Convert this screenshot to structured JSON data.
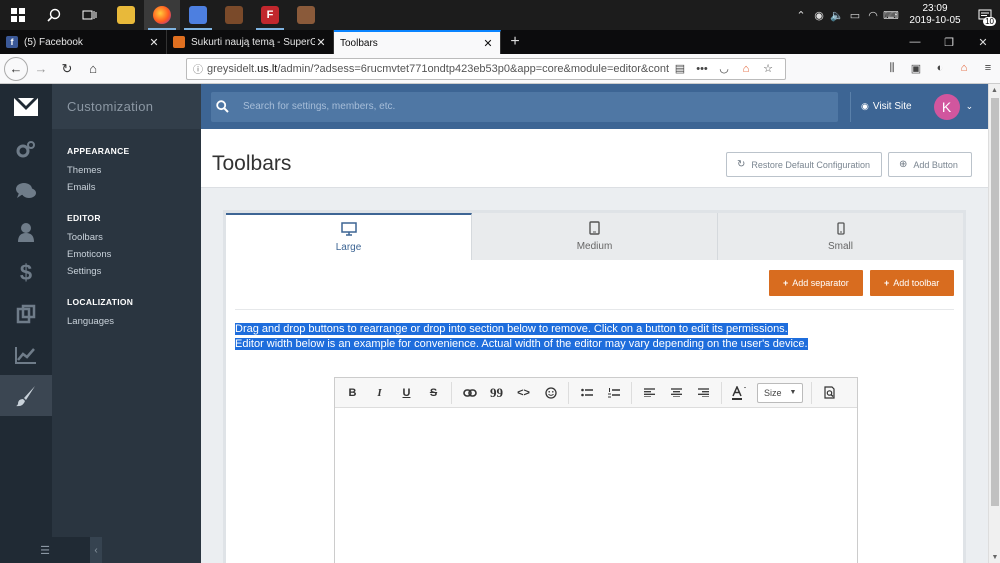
{
  "taskbar": {
    "clock_time": "23:09",
    "clock_date": "2019-10-05",
    "notification_count": "10"
  },
  "browser": {
    "tabs": [
      {
        "title": "(5) Facebook",
        "favicon_color": "#3b5998"
      },
      {
        "title": "Sukurti naują temą - SuperGam",
        "favicon_color": "#e07020"
      },
      {
        "title": "Toolbars",
        "favicon_color": "#ffffff"
      }
    ],
    "url_host": "greysidelt.",
    "url_domain": "us.lt",
    "url_path": "/admin/?adsess=6rucmvtet771ondtp423eb53p0&app=core&module=editor&cont"
  },
  "sidebar": {
    "section_title": "Customization",
    "groups": [
      {
        "heading": "APPEARANCE",
        "items": [
          "Themes",
          "Emails"
        ]
      },
      {
        "heading": "EDITOR",
        "items": [
          "Toolbars",
          "Emoticons",
          "Settings"
        ]
      },
      {
        "heading": "LOCALIZATION",
        "items": [
          "Languages"
        ]
      }
    ]
  },
  "header": {
    "search_placeholder": "Search for settings, members, etc.",
    "visit_site_label": "Visit Site",
    "avatar_initial": "K",
    "brand_color": "#3d6594"
  },
  "page": {
    "title": "Toolbars",
    "restore_label": "Restore Default Configuration",
    "add_button_label": "Add Button"
  },
  "panel": {
    "tabs": [
      {
        "label": "Large",
        "icon": "desktop-icon"
      },
      {
        "label": "Medium",
        "icon": "tablet-icon"
      },
      {
        "label": "Small",
        "icon": "phone-icon"
      }
    ],
    "add_separator_label": "Add separator",
    "add_toolbar_label": "Add toolbar",
    "accent_color": "#d86c1f",
    "help_line_1": "Drag and drop buttons to rearrange or drop into section below to remove. Click on a button to edit its permissions.",
    "help_line_2": "Editor width below is an example for convenience. Actual width of the editor may vary depending on the user's device."
  },
  "editor": {
    "bold": "B",
    "italic": "I",
    "underline": "U",
    "strike": "S",
    "quote": "99",
    "code": "<>",
    "size_label": "Size"
  }
}
